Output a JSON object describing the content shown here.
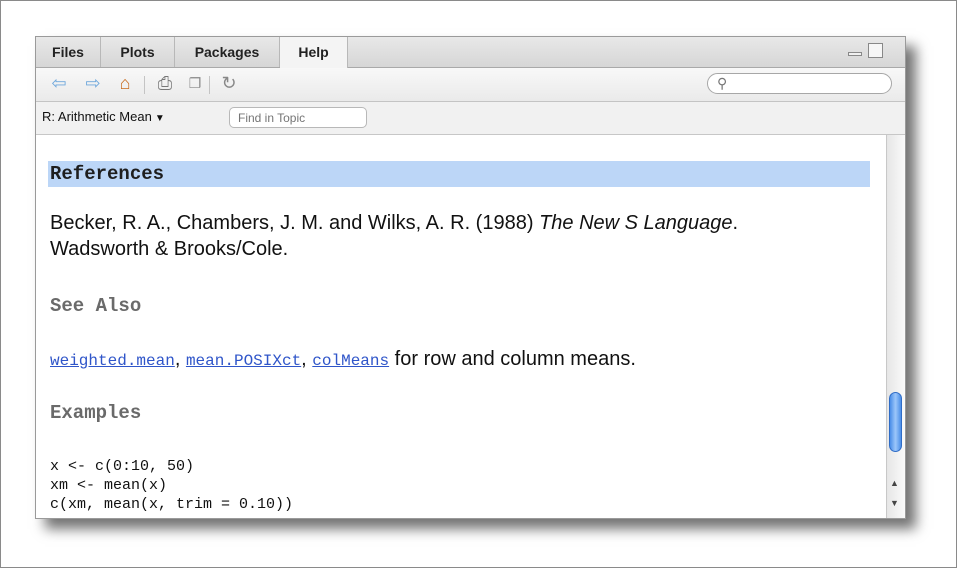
{
  "tabs": [
    {
      "label": "Files"
    },
    {
      "label": "Plots"
    },
    {
      "label": "Packages"
    },
    {
      "label": "Help"
    }
  ],
  "toolbar": {
    "icons": [
      "back-arrow-icon",
      "forward-arrow-icon",
      "home-icon",
      "print-icon",
      "popout-icon",
      "refresh-icon"
    ]
  },
  "search": {
    "placeholder": ""
  },
  "topic": {
    "selected": "R: Arithmetic Mean",
    "find_placeholder": "Find in Topic"
  },
  "content": {
    "references_heading": "References",
    "reference_part1": "Becker, R. A., Chambers, J. M. and Wilks, A. R. (1988) ",
    "reference_italic": "The New S Language",
    "reference_part2": ". Wadsworth & Brooks/Cole.",
    "see_also_heading": "See Also",
    "links": [
      "weighted.mean",
      "mean.POSIXct",
      "colMeans"
    ],
    "link_sep": ", ",
    "links_suffix": " for row and column means.",
    "examples_heading": "Examples",
    "code_lines": [
      "x <- c(0:10, 50)",
      "xm <- mean(x)",
      "c(xm, mean(x, trim = 0.10))"
    ]
  },
  "colors": {
    "accent": "#bcd6f7",
    "link": "#2f55c9",
    "scroll_thumb": "#4a8ee8"
  }
}
